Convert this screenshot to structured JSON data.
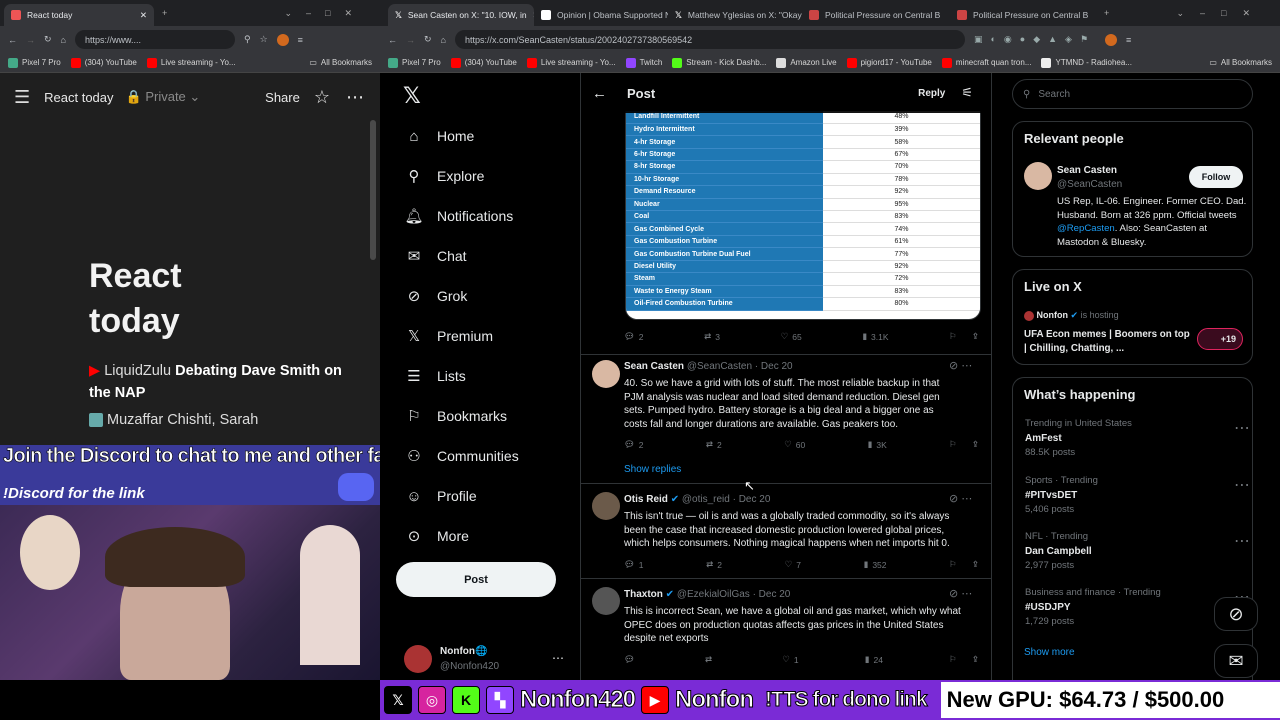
{
  "left_browser": {
    "tabs": [
      {
        "label": "React today"
      }
    ],
    "url": "https://www....",
    "bookmarks": [
      "Pixel 7 Pro",
      "(304) YouTube",
      "Live streaming - Yo..."
    ],
    "all_bookmarks": "All Bookmarks",
    "reader": {
      "title": "React today",
      "private": "Private",
      "share": "Share",
      "heading_line1": "React",
      "heading_line2": "today",
      "item1_source": "LiquidZulu",
      "item1_title": "Debating Dave Smith on the NAP",
      "item2_source": "Muzaffar Chishti, Sarah"
    }
  },
  "discord_overlay": {
    "title": "Join the Discord to chat to me and other fans!",
    "subtitle": "!Discord for the link"
  },
  "right_browser": {
    "tabs": [
      {
        "label": "Sean Casten on X: \"10. IOW, in"
      },
      {
        "label": "Opinion | Obama Supported N"
      },
      {
        "label": "Matthew Yglesias on X: \"Okay"
      },
      {
        "label": "Political Pressure on Central B"
      },
      {
        "label": "Political Pressure on Central B"
      }
    ],
    "url": "https://x.com/SeanCasten/status/200240273738056954​2",
    "bookmarks": [
      "Pixel 7 Pro",
      "(304) YouTube",
      "Live streaming - Yo...",
      "Twitch",
      "Stream - Kick Dashb...",
      "Amazon Live",
      "pigiord17 - YouTube",
      "minecraft quan tron...",
      "YTMND - Radiohea..."
    ],
    "all_bookmarks": "All Bookmarks"
  },
  "x_nav": {
    "items": [
      "Home",
      "Explore",
      "Notifications",
      "Chat",
      "Grok",
      "Premium",
      "Lists",
      "Bookmarks",
      "Communities",
      "Profile",
      "More"
    ],
    "post_button": "Post",
    "account_name": "Nonfon🌐",
    "account_handle": "@Nonfon420"
  },
  "post_header": {
    "back": "←",
    "title": "Post",
    "reply": "Reply"
  },
  "image_table": {
    "rows": [
      {
        "name": "Landfill Intermittent",
        "value": "48%"
      },
      {
        "name": "Hydro Intermittent",
        "value": "39%"
      },
      {
        "name": "4-hr Storage",
        "value": "58%"
      },
      {
        "name": "6-hr Storage",
        "value": "67%"
      },
      {
        "name": "8-hr Storage",
        "value": "70%"
      },
      {
        "name": "10-hr Storage",
        "value": "78%"
      },
      {
        "name": "Demand Resource",
        "value": "92%"
      },
      {
        "name": "Nuclear",
        "value": "95%"
      },
      {
        "name": "Coal",
        "value": "83%"
      },
      {
        "name": "Gas Combined Cycle",
        "value": "74%"
      },
      {
        "name": "Gas Combustion Turbine",
        "value": "61%"
      },
      {
        "name": "Gas Combustion Turbine Dual Fuel",
        "value": "77%"
      },
      {
        "name": "Diesel Utility",
        "value": "92%"
      },
      {
        "name": "Steam",
        "value": "72%"
      },
      {
        "name": "Waste to Energy Steam",
        "value": "83%"
      },
      {
        "name": "Oil-Fired Combustion Turbine",
        "value": "80%"
      }
    ]
  },
  "image_actions": {
    "replies": "2",
    "reposts": "3",
    "likes": "65",
    "views": "3.1K"
  },
  "tweets": [
    {
      "name": "Sean Casten",
      "handle": "@SeanCasten",
      "date": "· Dec 20",
      "verified": false,
      "text": "40. So we have a grid with lots of stuff. The most reliable backup in that PJM analysis was nuclear and load sited demand reduction.  Diesel gen sets. Pumped hydro.  Battery storage is a big deal and a bigger one as costs fall and longer durations are available. Gas peakers too.",
      "replies": "2",
      "reposts": "2",
      "likes": "60",
      "views": "3K"
    },
    {
      "name": "Otis Reid",
      "handle": "@otis_reid",
      "date": "· Dec 20",
      "verified": true,
      "text": "This isn't true — oil is and was a globally traded commodity, so it's always been the case that increased domestic production lowered global prices, which helps consumers. Nothing magical happens when net imports hit 0.",
      "replies": "1",
      "reposts": "2",
      "likes": "7",
      "views": "352"
    },
    {
      "name": "Thaxton",
      "handle": "@EzekialOilGas",
      "date": "· Dec 20",
      "verified": true,
      "text": "This is incorrect Sean, we have a global oil and gas market, which why what OPEC does on production quotas affects gas prices in the United States despite net exports",
      "replies": "",
      "reposts": "",
      "likes": "1",
      "views": "24"
    }
  ],
  "show_replies": "Show replies",
  "right_column": {
    "search_placeholder": "Search",
    "relevant_title": "Relevant people",
    "person": {
      "name": "Sean Casten",
      "handle": "@SeanCasten",
      "follow": "Follow",
      "bio_pre": "US Rep, IL-06. Engineer. Former CEO. Dad. Husband. Born at 326 ppm. Official tweets ",
      "bio_link": "@RepCasten",
      "bio_post": ". Also: SeanCasten at Mastodon & Bluesky."
    },
    "live_title": "Live on X",
    "live_host": "Nonfon",
    "live_status": "is hosting",
    "live_text": "UFA Econ memes | Boomers on top | Chilling, Chatting, ...",
    "live_count": "+19",
    "happening_title": "What’s happening",
    "trends": [
      {
        "context": "Trending in United States",
        "name": "AmFest",
        "posts": "88.5K posts"
      },
      {
        "context": "Sports · Trending",
        "name": "#PITvsDET",
        "posts": "5,406 posts"
      },
      {
        "context": "NFL · Trending",
        "name": "Dan Campbell",
        "posts": "2,977 posts"
      },
      {
        "context": "Business and finance · Trending",
        "name": "#USDJPY",
        "posts": "1,729 posts"
      }
    ],
    "show_more": "Show more"
  },
  "stream_bar": {
    "name1": "Nonfon420",
    "name2": "Nonfon",
    "tts": "!TTS for dono link",
    "goal": "New GPU: $64.73 / $500.00"
  },
  "colors": {
    "x_blue": "#1d9bf0",
    "stream_purple": "#7a2bd6",
    "table_blue": "#1f78b4"
  }
}
